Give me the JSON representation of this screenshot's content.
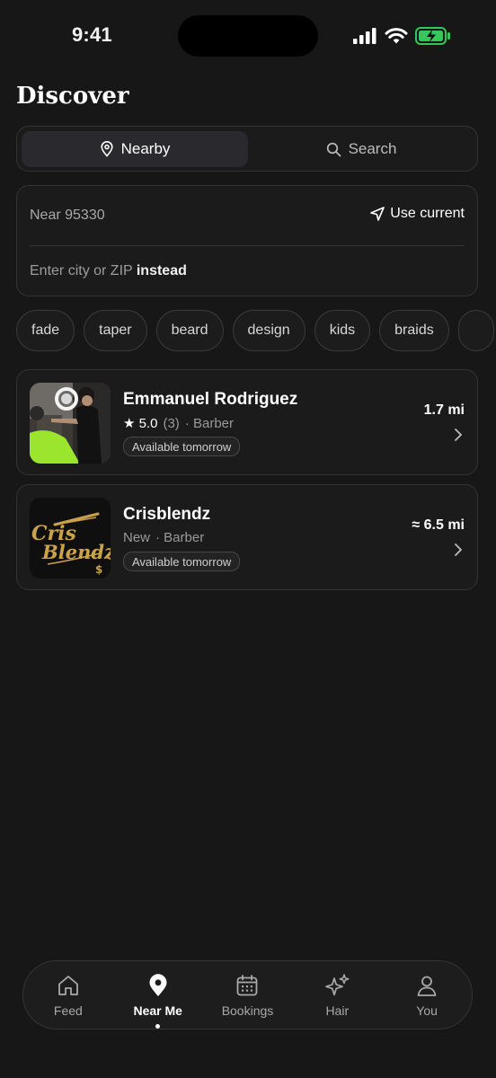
{
  "status": {
    "time": "9:41"
  },
  "page": {
    "title": "Discover"
  },
  "segment": {
    "nearby": "Nearby",
    "search": "Search"
  },
  "location": {
    "near": "Near 95330",
    "use_current": "Use current",
    "enter_prefix": "Enter city or ZIP ",
    "enter_bold": "instead"
  },
  "chips": [
    "fade",
    "taper",
    "beard",
    "design",
    "kids",
    "braids"
  ],
  "barbers": [
    {
      "name": "Emmanuel Rodriguez",
      "rating": "★ 5.0",
      "reviews": "(3)",
      "role": "· Barber",
      "availability": "Available tomorrow",
      "distance": "1.7 mi"
    },
    {
      "name": "Crisblendz",
      "rating": "New",
      "reviews": "",
      "role": "· Barber",
      "availability": "Available tomorrow",
      "distance": "≈ 6.5 mi",
      "logo_text_1": "Cris",
      "logo_text_2": "Blendz"
    }
  ],
  "tabs": [
    {
      "label": "Feed",
      "icon": "house-icon"
    },
    {
      "label": "Near Me",
      "icon": "map-pin-icon"
    },
    {
      "label": "Bookings",
      "icon": "calendar-icon"
    },
    {
      "label": "Hair",
      "icon": "sparkles-icon"
    },
    {
      "label": "You",
      "icon": "user-icon"
    }
  ],
  "colors": {
    "background": "#171717",
    "battery": "#34c759",
    "logo_gold": "#c9a24a"
  }
}
